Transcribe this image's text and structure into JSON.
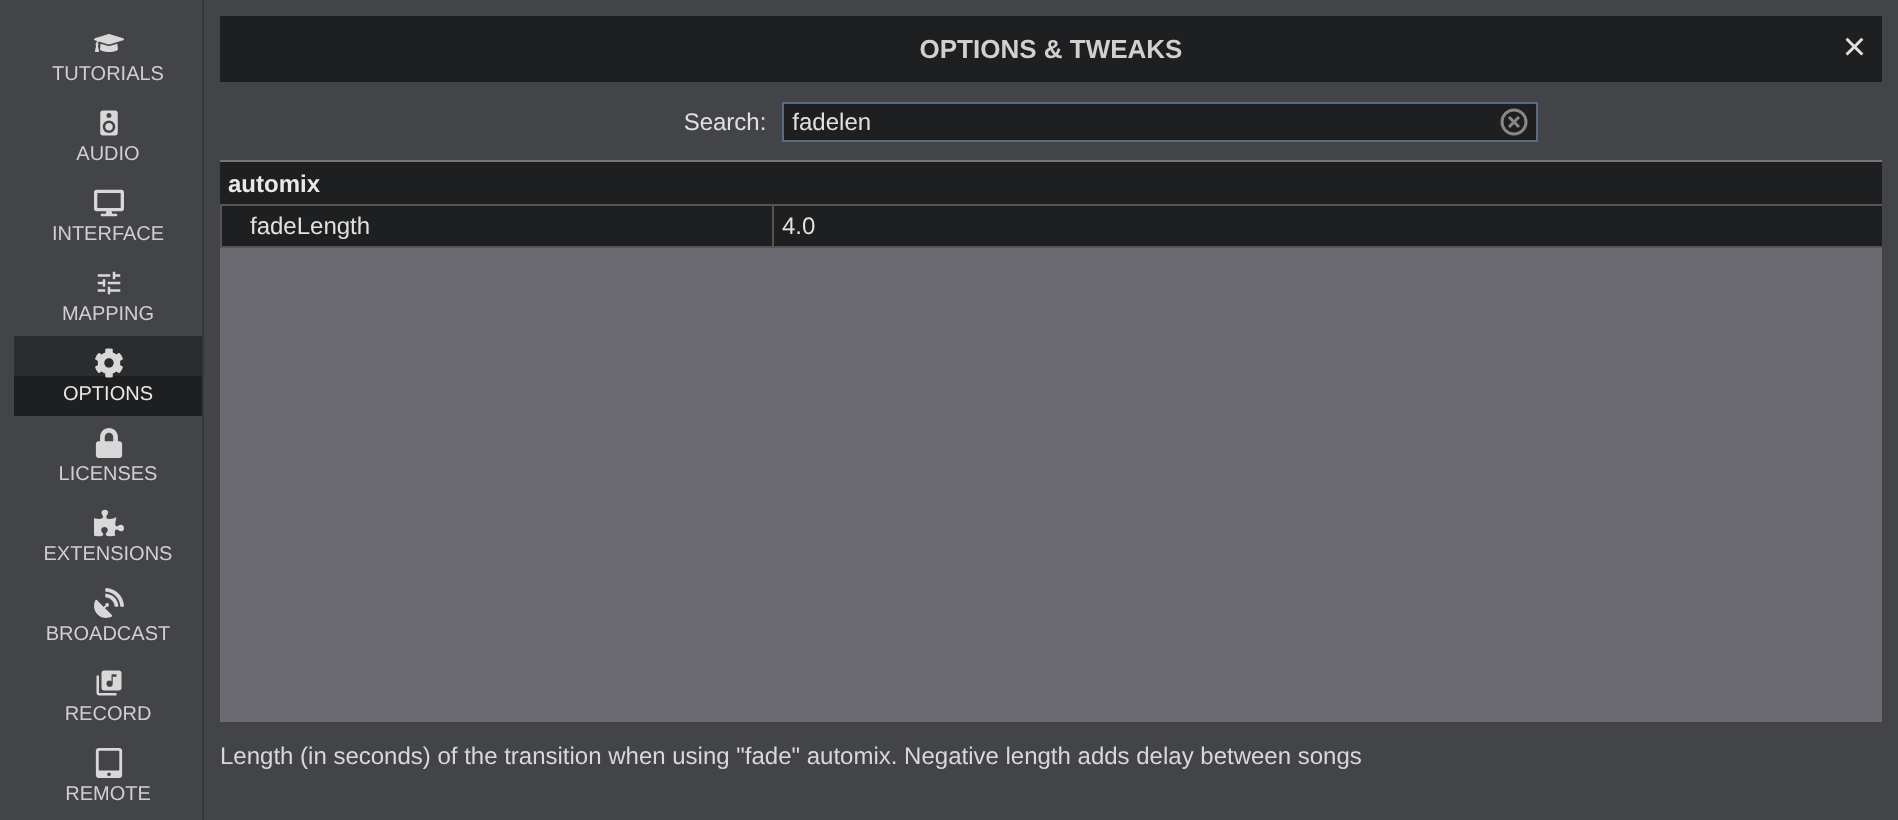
{
  "sidebar": {
    "items": [
      {
        "kind": "tutorials",
        "label": "TUTORIALS",
        "selected": false
      },
      {
        "kind": "audio",
        "label": "AUDIO",
        "selected": false
      },
      {
        "kind": "interface",
        "label": "INTERFACE",
        "selected": false
      },
      {
        "kind": "mapping",
        "label": "MAPPING",
        "selected": false
      },
      {
        "kind": "options",
        "label": "OPTIONS",
        "selected": true
      },
      {
        "kind": "licenses",
        "label": "LICENSES",
        "selected": false
      },
      {
        "kind": "extensions",
        "label": "EXTENSIONS",
        "selected": false
      },
      {
        "kind": "broadcast",
        "label": "BROADCAST",
        "selected": false
      },
      {
        "kind": "record",
        "label": "RECORD",
        "selected": false
      },
      {
        "kind": "remote",
        "label": "REMOTE",
        "selected": false
      }
    ]
  },
  "window": {
    "title": "OPTIONS & TWEAKS",
    "close": "×"
  },
  "search": {
    "label": "Search:",
    "value": "fadelen"
  },
  "table": {
    "groups": [
      {
        "name": "automix",
        "rows": [
          {
            "name": "fadeLength",
            "value": "4.0"
          }
        ]
      }
    ]
  },
  "description": "Length (in seconds) of the transition when using \"fade\" automix. Negative length adds delay between songs"
}
